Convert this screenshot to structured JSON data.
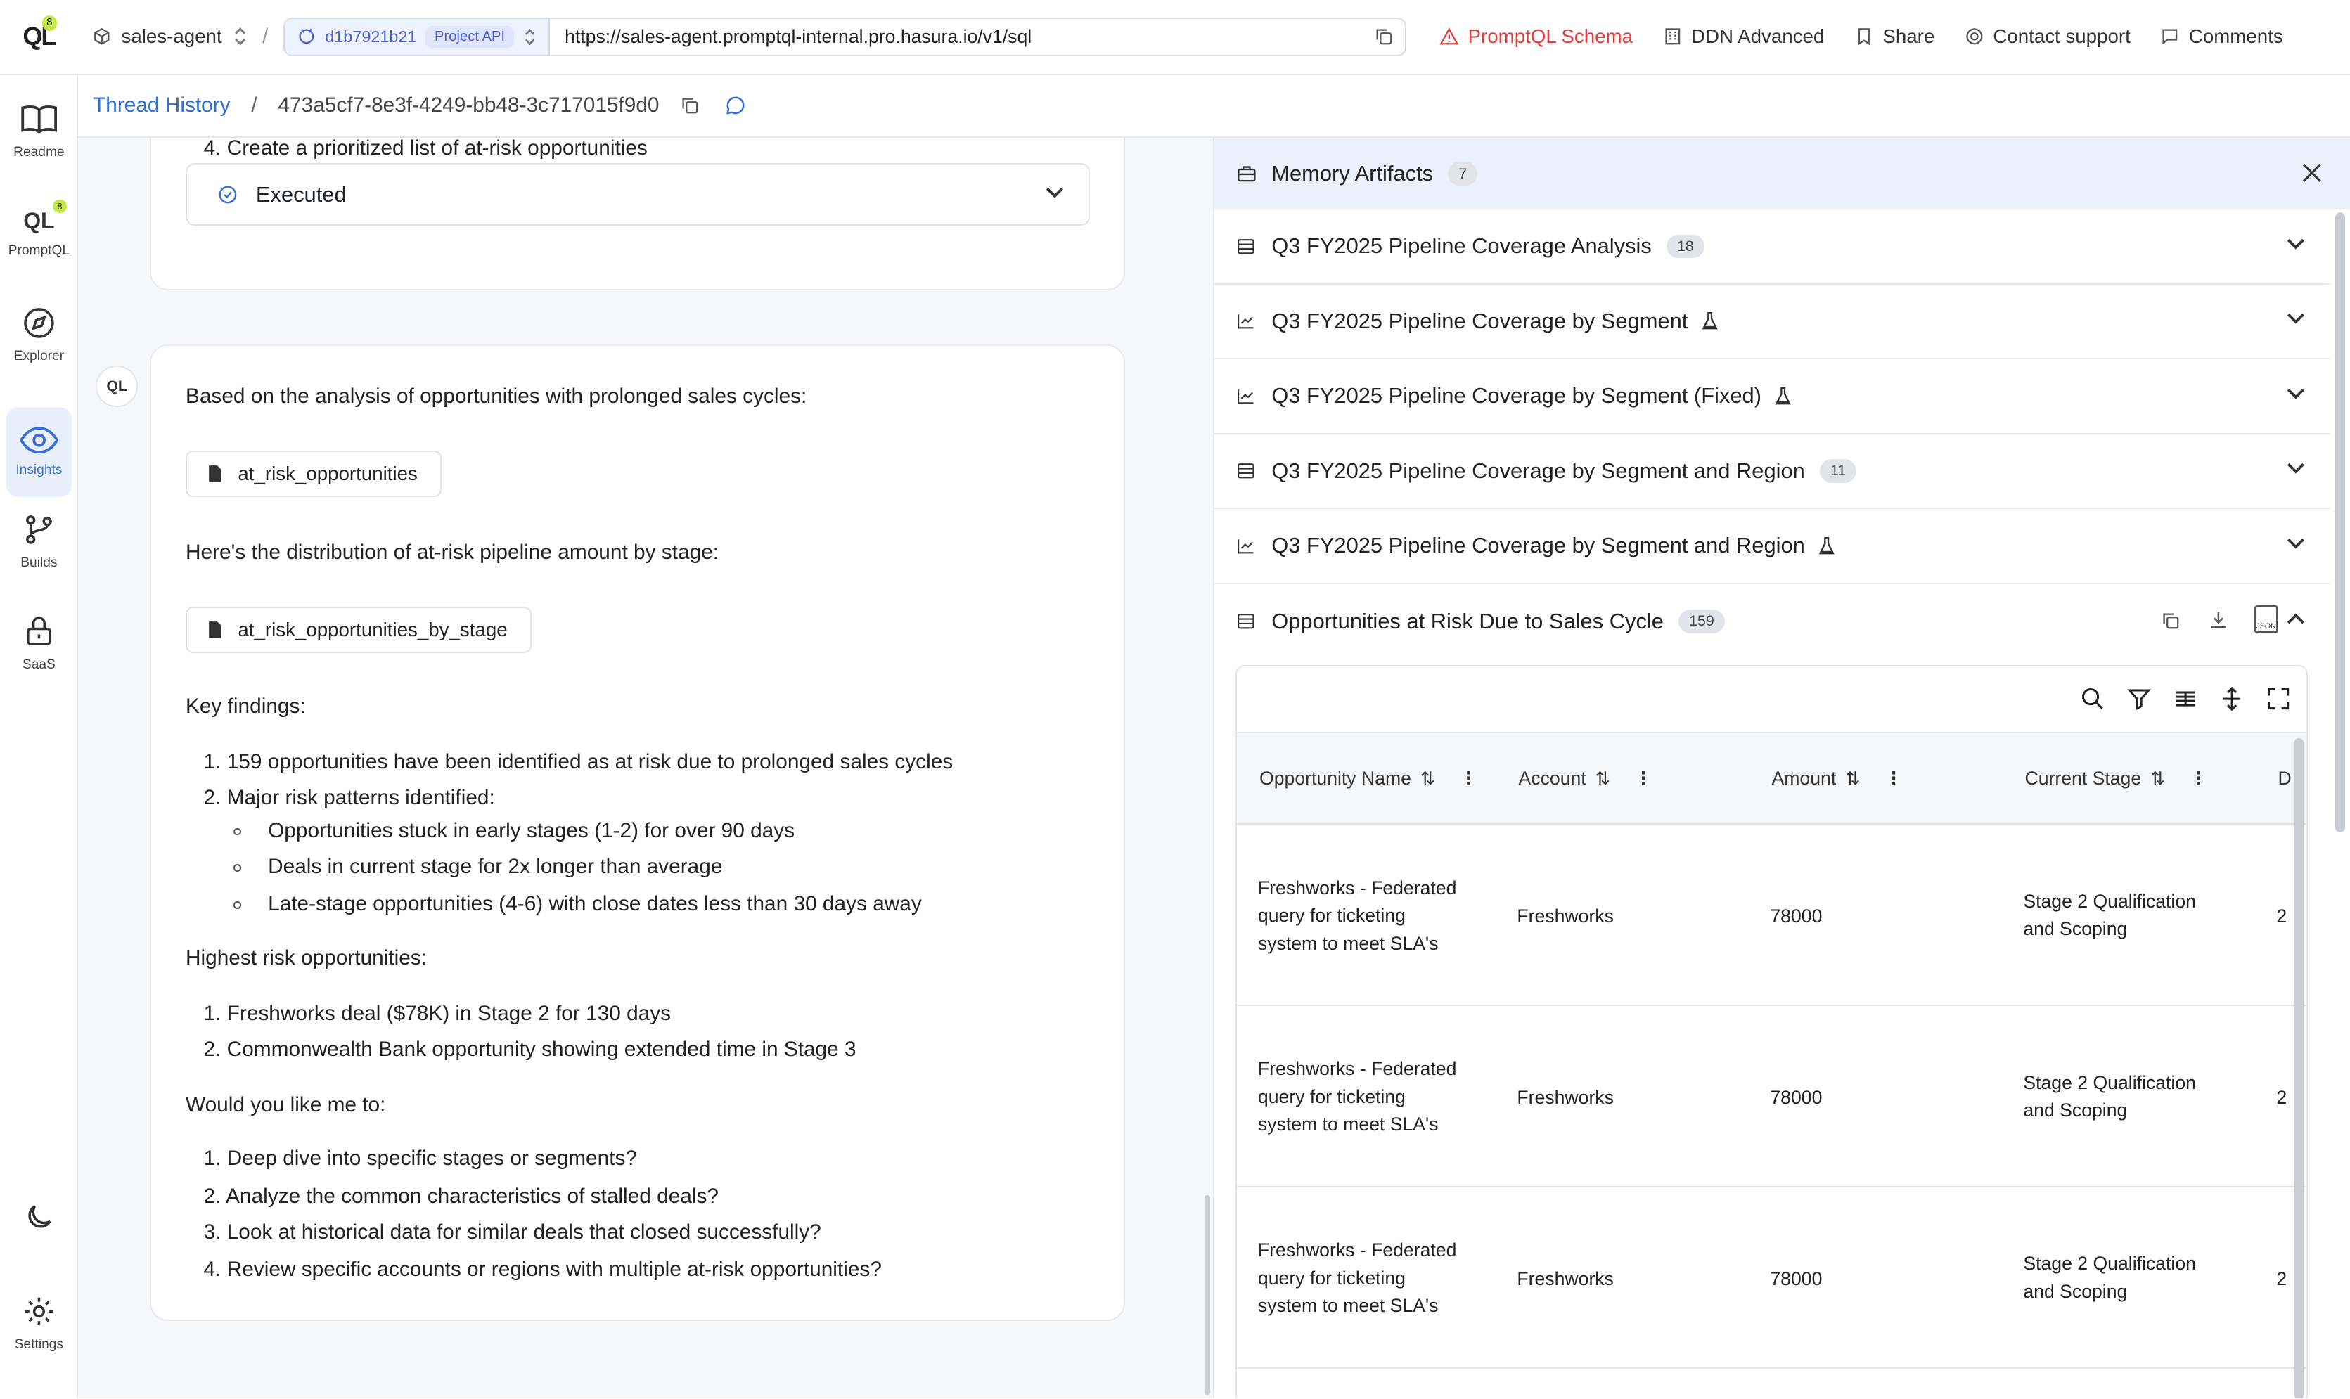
{
  "topbar": {
    "logo_badge": "8",
    "project_name": "sales-agent",
    "project_id": "d1b7921b21",
    "project_api_label": "Project API",
    "api_url": "https://sales-agent.promptql-internal.pro.hasura.io/v1/sql",
    "links": {
      "schema": "PromptQL Schema",
      "ddn": "DDN Advanced",
      "share": "Share",
      "support": "Contact support",
      "comments": "Comments"
    },
    "warn_color": "#e03c3c"
  },
  "sidebar": {
    "items": [
      {
        "label": "Readme",
        "icon": "book-icon"
      },
      {
        "label": "PromptQL",
        "icon": "promptql-icon",
        "badge": "8"
      },
      {
        "label": "Explorer",
        "icon": "compass-icon"
      },
      {
        "label": "Insights",
        "icon": "eye-icon"
      },
      {
        "label": "Builds",
        "icon": "git-branch-icon"
      },
      {
        "label": "SaaS",
        "icon": "lock-icon"
      }
    ],
    "settings_label": "Settings",
    "active_color": "#3a6fd8"
  },
  "breadcrumb": {
    "root": "Thread History",
    "separator": "/",
    "thread_id": "473a5cf7-8e3f-4249-bb48-3c717015f9d0"
  },
  "chat": {
    "prev_step": "4. Create a prioritized list of at-risk opportunities",
    "executed_label": "Executed",
    "avatar": "QL",
    "intro": "Based on the analysis of opportunities with prolonged sales cycles:",
    "artifact1": "at_risk_opportunities",
    "distribution": "Here's the distribution of at-risk pipeline amount by stage:",
    "artifact2": "at_risk_opportunities_by_stage",
    "key_findings_title": "Key findings:",
    "findings": [
      "1. 159 opportunities have been identified as at risk due to prolonged sales cycles",
      "2. Major risk patterns identified:"
    ],
    "patterns": [
      "Opportunities stuck in early stages (1-2) for over 90 days",
      "Deals in current stage for 2x longer than average",
      "Late-stage opportunities (4-6) with close dates less than 30 days away"
    ],
    "highest_title": "Highest risk opportunities:",
    "highest": [
      "1. Freshworks deal ($78K) in Stage 2 for 130 days",
      "2. Commonwealth Bank opportunity showing extended time in Stage 3"
    ],
    "question": "Would you like me to:",
    "options": [
      "1. Deep dive into specific stages or segments?",
      "2. Analyze the common characteristics of stalled deals?",
      "3. Look at historical data for similar deals that closed successfully?",
      "4. Review specific accounts or regions with multiple at-risk opportunities?"
    ]
  },
  "panel": {
    "title": "Memory Artifacts",
    "count": "7",
    "artifacts": [
      {
        "name": "Q3 FY2025 Pipeline Coverage Analysis",
        "count": "18",
        "kind": "table-icon"
      },
      {
        "name": "Q3 FY2025 Pipeline Coverage by Segment",
        "count": "",
        "kind": "chart-icon"
      },
      {
        "name": "Q3 FY2025 Pipeline Coverage by Segment (Fixed)",
        "count": "",
        "kind": "chart-icon"
      },
      {
        "name": "Q3 FY2025 Pipeline Coverage by Segment and Region",
        "count": "11",
        "kind": "table-icon"
      },
      {
        "name": "Q3 FY2025 Pipeline Coverage by Segment and Region",
        "count": "",
        "kind": "chart-icon"
      },
      {
        "name": "Opportunities at Risk Due to Sales Cycle",
        "count": "159",
        "kind": "table-icon"
      }
    ],
    "json_label": "JSON",
    "table": {
      "columns": [
        "Opportunity Name",
        "Account",
        "Amount",
        "Current Stage",
        "D"
      ],
      "rows": [
        {
          "name": [
            "Freshworks - Federated",
            "query for ticketing",
            "system to meet SLA's"
          ],
          "account": "Freshworks",
          "amount": "78000",
          "stage": [
            "Stage 2 Qualification",
            "and Scoping"
          ],
          "extra": "2"
        },
        {
          "name": [
            "Freshworks - Federated",
            "query for ticketing",
            "system to meet SLA's"
          ],
          "account": "Freshworks",
          "amount": "78000",
          "stage": [
            "Stage 2 Qualification",
            "and Scoping"
          ],
          "extra": "2"
        },
        {
          "name": [
            "Freshworks - Federated",
            "query for ticketing",
            "system to meet SLA's"
          ],
          "account": "Freshworks",
          "amount": "78000",
          "stage": [
            "Stage 2 Qualification",
            "and Scoping"
          ],
          "extra": "2"
        }
      ]
    }
  }
}
